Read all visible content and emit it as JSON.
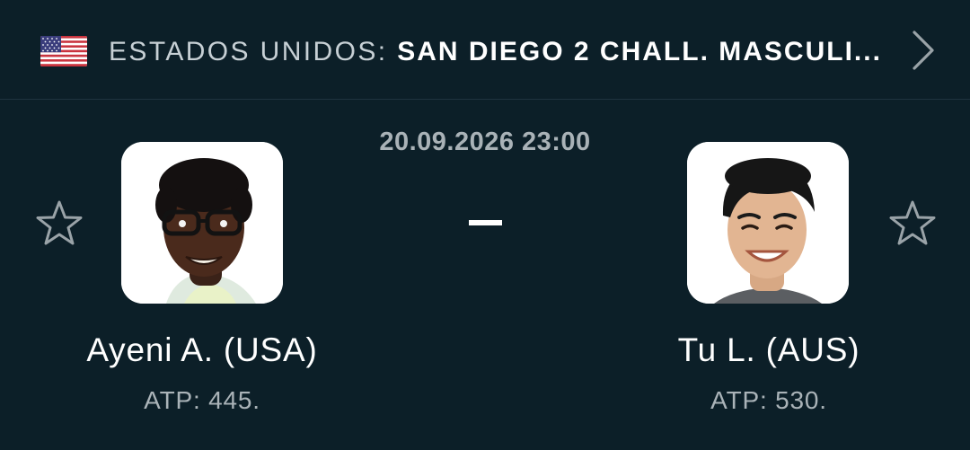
{
  "header": {
    "flag_icon": "usa-flag-icon",
    "country": "ESTADOS UNIDOS: ",
    "tournament": "SAN DIEGO 2 CHALL. MASCULI...",
    "chevron_icon": "chevron-right-icon"
  },
  "match": {
    "datetime": "20.09.2026 23:00",
    "score": "-"
  },
  "home": {
    "name": "Ayeni A. (USA)",
    "rank": "ATP: 445.",
    "favorite_icon": "star-outline-icon",
    "avatar_icon": "player-photo"
  },
  "away": {
    "name": "Tu L. (AUS)",
    "rank": "ATP: 530.",
    "favorite_icon": "star-outline-icon",
    "avatar_icon": "player-photo"
  },
  "colors": {
    "background": "#0c1f28",
    "divider": "#1f3440",
    "muted_text": "#a9b2b7",
    "icon_gray": "#9aa3a8"
  }
}
